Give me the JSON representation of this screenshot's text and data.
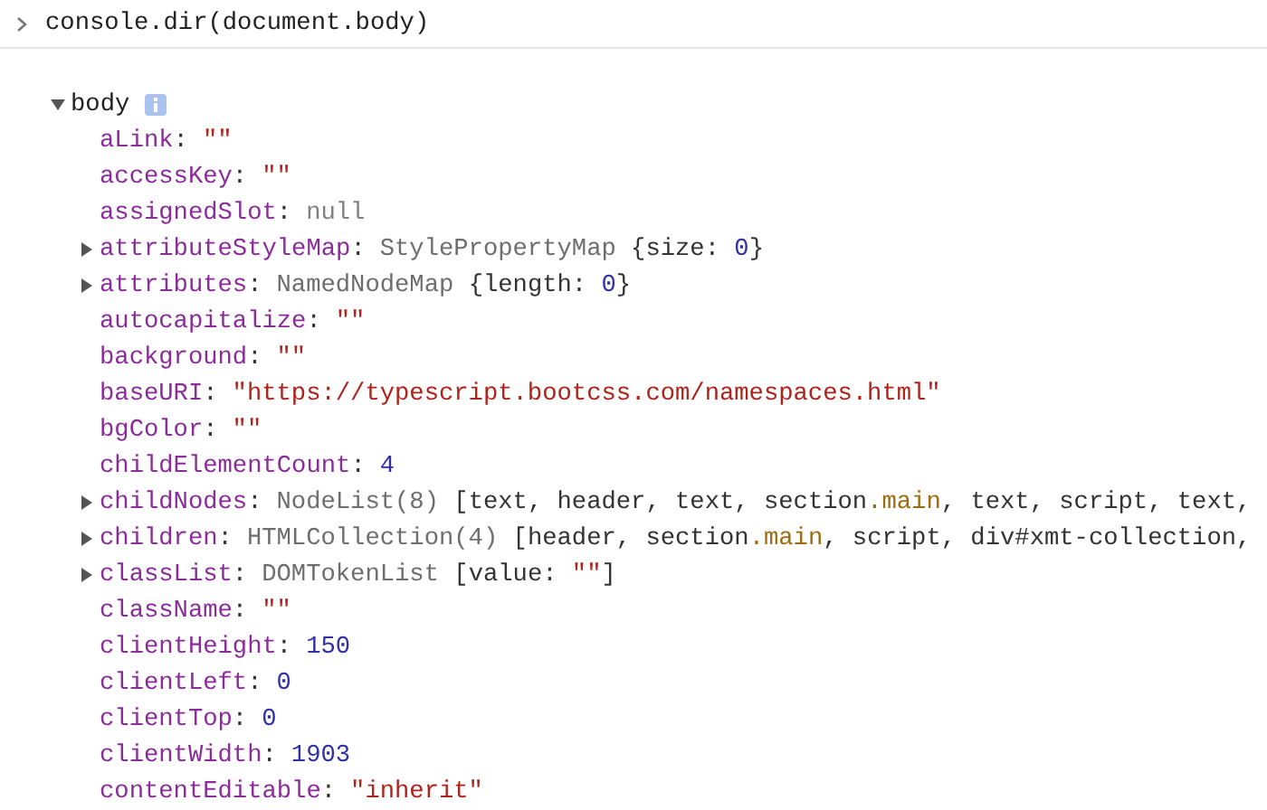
{
  "command": "console.dir(document.body)",
  "separator": ":",
  "object": {
    "name": "body",
    "expanded": true,
    "properties": [
      {
        "key": "aLink",
        "expandable": false,
        "value": [
          {
            "kind": "string",
            "text": "\"\""
          }
        ]
      },
      {
        "key": "accessKey",
        "expandable": false,
        "value": [
          {
            "kind": "string",
            "text": "\"\""
          }
        ]
      },
      {
        "key": "assignedSlot",
        "expandable": false,
        "value": [
          {
            "kind": "null",
            "text": "null"
          }
        ]
      },
      {
        "key": "attributeStyleMap",
        "expandable": true,
        "expanded": false,
        "value": [
          {
            "kind": "type",
            "text": "StylePropertyMap "
          },
          {
            "kind": "plain",
            "text": "{size: "
          },
          {
            "kind": "number",
            "text": "0"
          },
          {
            "kind": "plain",
            "text": "}"
          }
        ]
      },
      {
        "key": "attributes",
        "expandable": true,
        "expanded": false,
        "value": [
          {
            "kind": "type",
            "text": "NamedNodeMap "
          },
          {
            "kind": "plain",
            "text": "{length: "
          },
          {
            "kind": "number",
            "text": "0"
          },
          {
            "kind": "plain",
            "text": "}"
          }
        ]
      },
      {
        "key": "autocapitalize",
        "expandable": false,
        "value": [
          {
            "kind": "string",
            "text": "\"\""
          }
        ]
      },
      {
        "key": "background",
        "expandable": false,
        "value": [
          {
            "kind": "string",
            "text": "\"\""
          }
        ]
      },
      {
        "key": "baseURI",
        "expandable": false,
        "value": [
          {
            "kind": "string",
            "text": "\"https://typescript.bootcss.com/namespaces.html\""
          }
        ]
      },
      {
        "key": "bgColor",
        "expandable": false,
        "value": [
          {
            "kind": "string",
            "text": "\"\""
          }
        ]
      },
      {
        "key": "childElementCount",
        "expandable": false,
        "value": [
          {
            "kind": "number",
            "text": "4"
          }
        ]
      },
      {
        "key": "childNodes",
        "expandable": true,
        "expanded": false,
        "value": [
          {
            "kind": "type",
            "text": "NodeList(8) "
          },
          {
            "kind": "plain",
            "text": "[text, header, text, section"
          },
          {
            "kind": "class",
            "text": ".main"
          },
          {
            "kind": "plain",
            "text": ", text, script, text,"
          }
        ]
      },
      {
        "key": "children",
        "expandable": true,
        "expanded": false,
        "value": [
          {
            "kind": "type",
            "text": "HTMLCollection(4) "
          },
          {
            "kind": "plain",
            "text": "[header, section"
          },
          {
            "kind": "class",
            "text": ".main"
          },
          {
            "kind": "plain",
            "text": ", script, div#xmt-collection,"
          }
        ]
      },
      {
        "key": "classList",
        "expandable": true,
        "expanded": false,
        "value": [
          {
            "kind": "type",
            "text": "DOMTokenList "
          },
          {
            "kind": "plain",
            "text": "[value: "
          },
          {
            "kind": "string",
            "text": "\"\""
          },
          {
            "kind": "plain",
            "text": "]"
          }
        ]
      },
      {
        "key": "className",
        "expandable": false,
        "value": [
          {
            "kind": "string",
            "text": "\"\""
          }
        ]
      },
      {
        "key": "clientHeight",
        "expandable": false,
        "value": [
          {
            "kind": "number",
            "text": "150"
          }
        ]
      },
      {
        "key": "clientLeft",
        "expandable": false,
        "value": [
          {
            "kind": "number",
            "text": "0"
          }
        ]
      },
      {
        "key": "clientTop",
        "expandable": false,
        "value": [
          {
            "kind": "number",
            "text": "0"
          }
        ]
      },
      {
        "key": "clientWidth",
        "expandable": false,
        "value": [
          {
            "kind": "number",
            "text": "1903"
          }
        ]
      },
      {
        "key": "contentEditable",
        "expandable": false,
        "value": [
          {
            "kind": "string",
            "text": "\"inherit\""
          }
        ]
      }
    ]
  }
}
